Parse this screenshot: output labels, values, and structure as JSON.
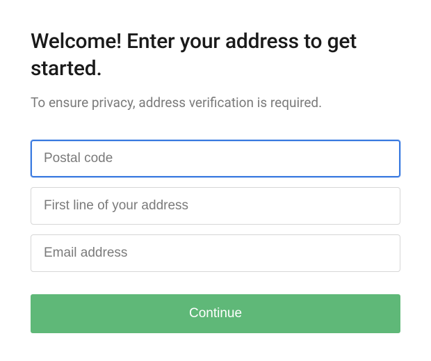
{
  "heading": "Welcome! Enter your address to get started.",
  "subheading": "To ensure privacy, address verification is required.",
  "form": {
    "postal_code": {
      "placeholder": "Postal code",
      "value": ""
    },
    "address_line": {
      "placeholder": "First line of your address",
      "value": ""
    },
    "email": {
      "placeholder": "Email address",
      "value": ""
    },
    "submit_label": "Continue"
  }
}
